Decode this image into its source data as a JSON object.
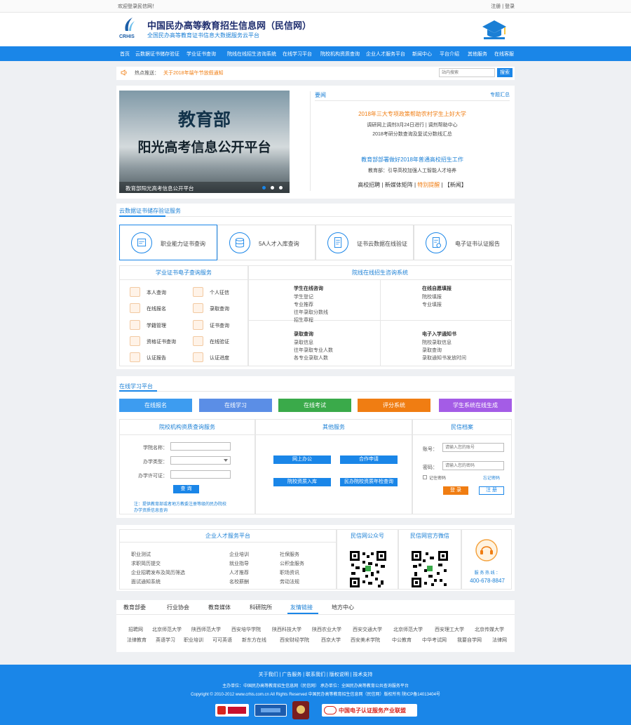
{
  "topbar": {
    "welcome": "欢迎登录民信网！",
    "register": "注册",
    "sep": "|",
    "login": "登录"
  },
  "header": {
    "logo_text": "CRHIS",
    "title": "中国民办高等教育招生信息网（民信网）",
    "subtitle": "全国民办高等教育证书信息大数据服务云平台"
  },
  "nav": [
    "首页",
    "云数据证书储存验证",
    "学业证书查询",
    "院线在线招生咨询系统",
    "在线学习平台",
    "院校机构资质查询",
    "企业人才服务平台",
    "新闻中心",
    "平台介绍",
    "其他服务",
    "在线客服"
  ],
  "hot": {
    "label": "热点推送：",
    "text": "关于2018年端午节放假通知",
    "search_placeholder": "站内搜索",
    "search_btn": "搜索"
  },
  "banner": {
    "line1": "教育部",
    "line2": "阳光高考信息公开平台",
    "caption": "教育部阳光高考信息公开平台"
  },
  "news": {
    "header": "要闻",
    "more": "专题汇总",
    "h1": "2018年三大专项政策帮助农村学生上好大学",
    "l1": "调研网上调剂3月24日进行 | 调剂帮助中心",
    "l2": "2018考研分数查询及复试分数线汇总",
    "h2": "教育部部署做好2018年普通高校招生工作",
    "l3": "教育部：引导高校加强人工智能人才培养",
    "links": [
      "高校招聘",
      "新媒体矩阵",
      "特别提醒",
      "【新闻】"
    ]
  },
  "cloud": {
    "title": "云数据证书储存验证服务",
    "items": [
      "职业能力证书查询",
      "5A人才入库查询",
      "证书云数据在线验证",
      "电子证书认证报告"
    ]
  },
  "cert": {
    "title": "学业证书电子查询服务",
    "items": [
      "本人查询",
      "个人征信",
      "在线报名",
      "录取查询",
      "学籍管理",
      "证书查询",
      "资格证书查询",
      "在线验证",
      "认证报告",
      "认证进度"
    ]
  },
  "consult": {
    "title": "院线在线招生咨询系统",
    "g1": {
      "title": "学生在线咨询",
      "items": [
        "学生登记",
        "专业推荐",
        "往年录取分数线",
        "招生章程"
      ]
    },
    "g2": {
      "title": "在线自愿填报",
      "items": [
        "院校填报",
        "专业填报"
      ]
    },
    "g3": {
      "title": "录取查询",
      "items": [
        "录取信息",
        "往年录取专业人数",
        "各专业录取人数"
      ]
    },
    "g4": {
      "title": "电子入学通知书",
      "items": [
        "院校录取信息",
        "录取查询",
        "录取通知书发放时间"
      ]
    }
  },
  "learn": {
    "title": "在线学习平台",
    "buttons": [
      "在线报名",
      "在线学习",
      "在线考试",
      "评分系统",
      "学生系统在线生成"
    ],
    "colors": [
      "#3d9cf0",
      "#5b8ee6",
      "#3aaa4a",
      "#f07d12",
      "#a45ce6"
    ]
  },
  "qual": {
    "title": "院校机构资质查询服务",
    "f1": "学院名称：",
    "f2": "办学类型：",
    "f3": "办学许可证：",
    "btn": "查 询",
    "note1": "注：提供教育部或者地方教委注册等级的民办院校",
    "note2": "办学资质信息查询"
  },
  "other": {
    "title": "其他服务",
    "items": [
      "网上办公",
      "合作申请",
      "院校资质入库",
      "民办院校资质年检查询"
    ]
  },
  "account": {
    "title": "民信档案",
    "acc_label": "账号：",
    "acc_ph": "请输入您的账号",
    "pwd_label": "密码：",
    "pwd_ph": "请输入您的密码",
    "remember": "记住密码",
    "forgot": "忘记密码",
    "login": "登 录",
    "register": "注 册"
  },
  "talent": {
    "title": "企业人才服务平台",
    "c1": [
      "职业测试",
      "求职简历提交",
      "企业招聘发布及简历筛选",
      "面试通知系统"
    ],
    "c2": [
      "企业培训",
      "就业指导",
      "人才推荐",
      "名校薪酬"
    ],
    "c3": [
      "社保服务",
      "公积金服务",
      "职场资讯",
      "劳动法规"
    ]
  },
  "wx": {
    "t1": "民信网公众号",
    "t2": "民信网官方微信"
  },
  "hotline": {
    "label": "服 务 热 线 ：",
    "number": "400-678-8847"
  },
  "links": {
    "tabs": [
      "教育部委",
      "行业协会",
      "教育媒体",
      "科研院所",
      "友情链接",
      "地方中心"
    ],
    "row1": [
      "招聘网",
      "北京师范大学",
      "陕西师范大学",
      "西安培华学院",
      "陕西科技大学",
      "陕西农业大学",
      "西安交通大学",
      "北京师范大学",
      "西安理工大学",
      "北京传媒大学"
    ],
    "row2": [
      "法律教育",
      "英语学习",
      "职业培训",
      "可可英语",
      "新东方在线",
      "西安财经学院",
      "西京大学",
      "西安美术学院",
      "中公教育",
      "中华考试网",
      "我要自学网",
      "法律网"
    ]
  },
  "footer": {
    "links": "关于我们 | 广告服务 | 联系我们 | 版权说明 | 技术支持",
    "host": "主办单位：中国民办高等教育招生信息网（民信网）      承办单位：全国民办高等教育公共查询服务平台",
    "copy": "Copyright © 2010-2012 www.crhis.com.cn All Rights Reserved 中国民办高等教育招生信息网（民信网）版权所有 陕ICP备14013404号",
    "badge4": "中国电子认证服务产业联盟"
  }
}
